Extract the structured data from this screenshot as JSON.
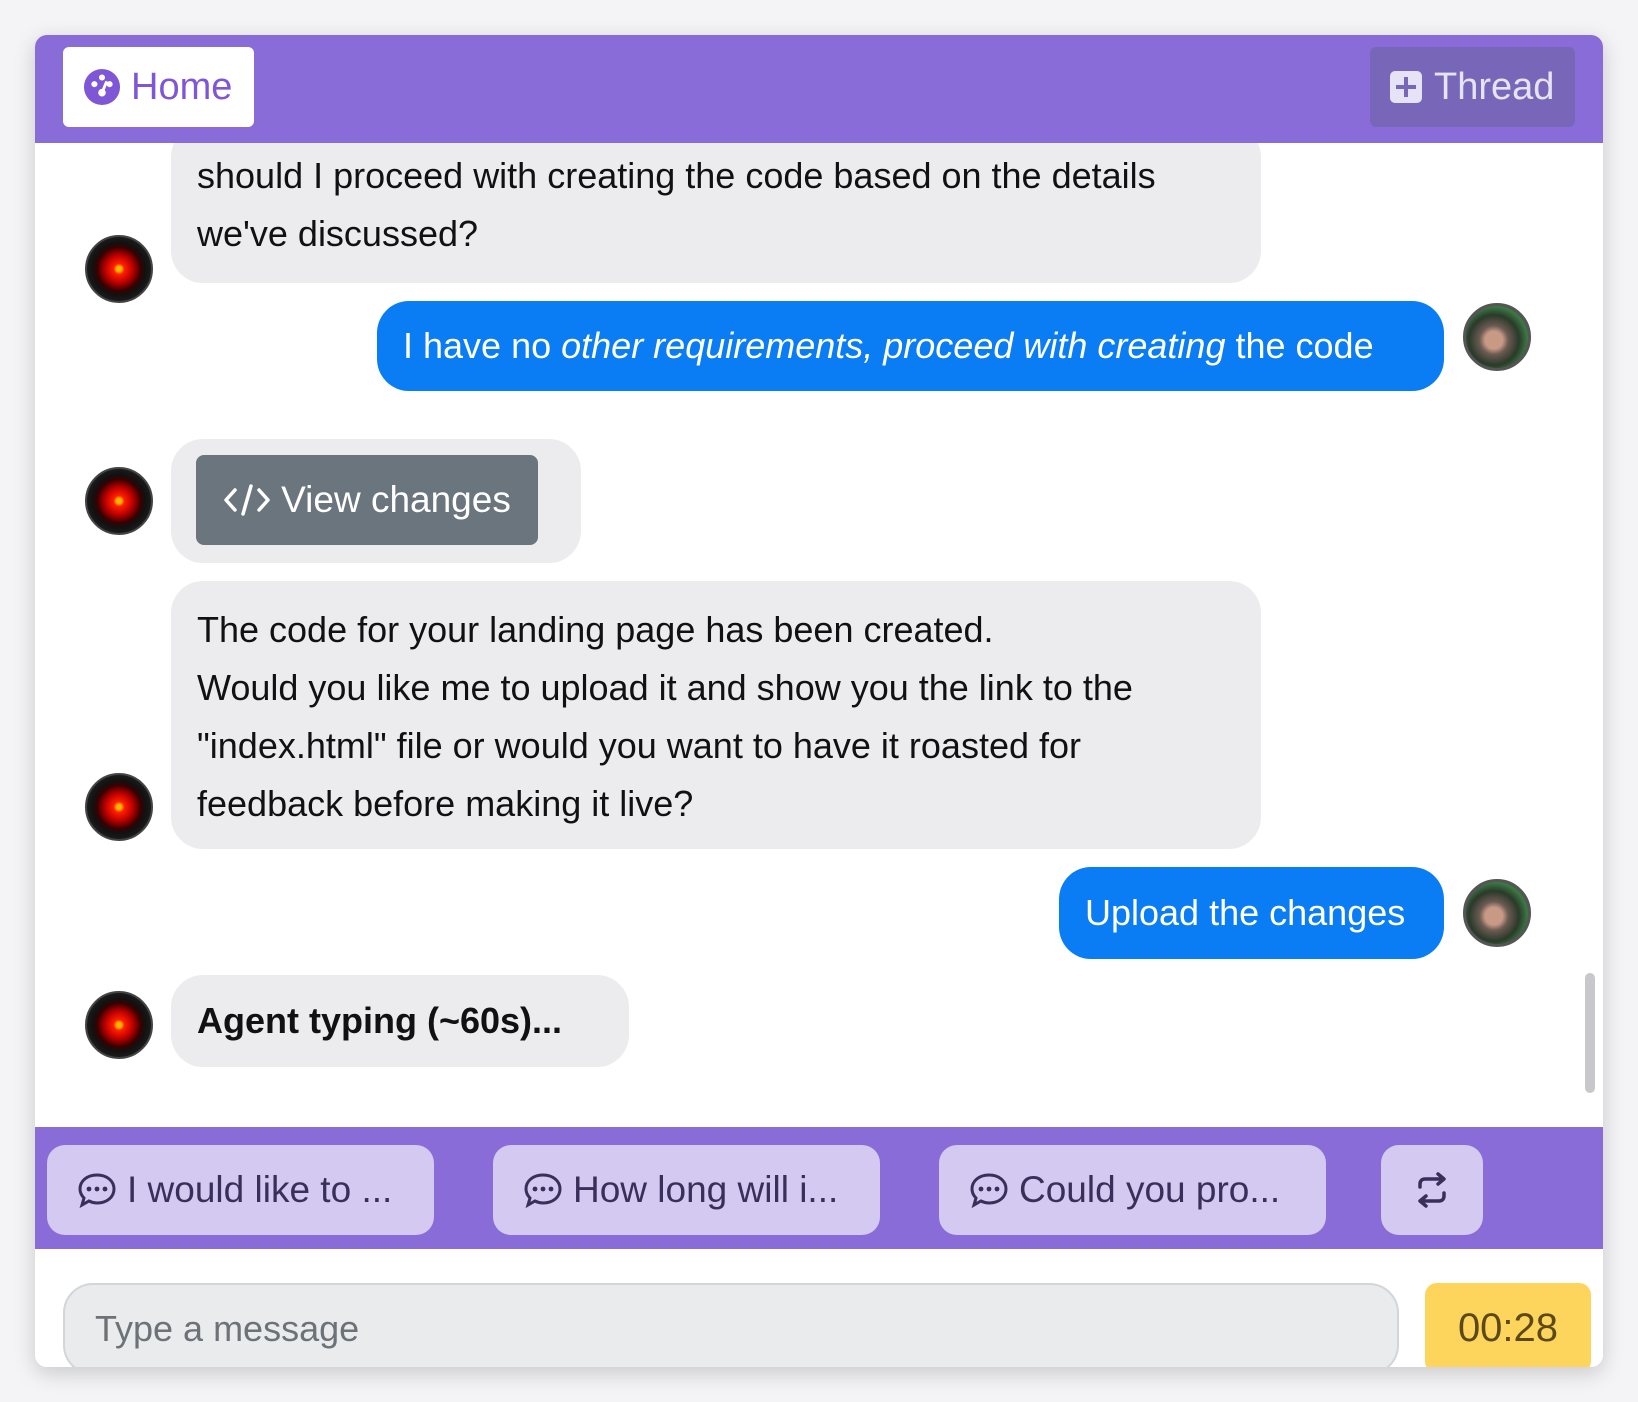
{
  "header": {
    "home_label": "Home",
    "home_icon": "dashboard-icon",
    "thread_label": "Thread",
    "thread_icon": "plus-square-icon"
  },
  "messages": [
    {
      "role": "agent",
      "lines": [
        "should I proceed with creating the code based on the details",
        "we've discussed?"
      ]
    },
    {
      "role": "user",
      "prefix": "I have no ",
      "emphasis": "other requirements, proceed with creating",
      "suffix": " the code"
    },
    {
      "role": "agent",
      "button_label": "View changes",
      "button_icon": "code-icon"
    },
    {
      "role": "agent",
      "lines": [
        "The code for your landing page has been created.",
        "Would you like me to upload it and show you the link to the",
        "\"index.html\" file or would you want to have it roasted for",
        "feedback before making it live?"
      ]
    },
    {
      "role": "user",
      "text": "Upload the changes"
    },
    {
      "role": "agent",
      "text": "Agent typing (~60s)..."
    }
  ],
  "suggestions": [
    {
      "label": "I would like to ...",
      "icon": "chat-bubble-icon"
    },
    {
      "label": "How long will i...",
      "icon": "chat-bubble-icon"
    },
    {
      "label": "Could you pro...",
      "icon": "chat-bubble-icon"
    }
  ],
  "refresh_icon": "repeat-icon",
  "input": {
    "placeholder": "Type a message",
    "value": ""
  },
  "timer": "00:28",
  "colors": {
    "brand": "#8a6cd8",
    "user_bubble": "#0a7cf4",
    "agent_bubble": "#ececee",
    "timer": "#fdd45c"
  }
}
